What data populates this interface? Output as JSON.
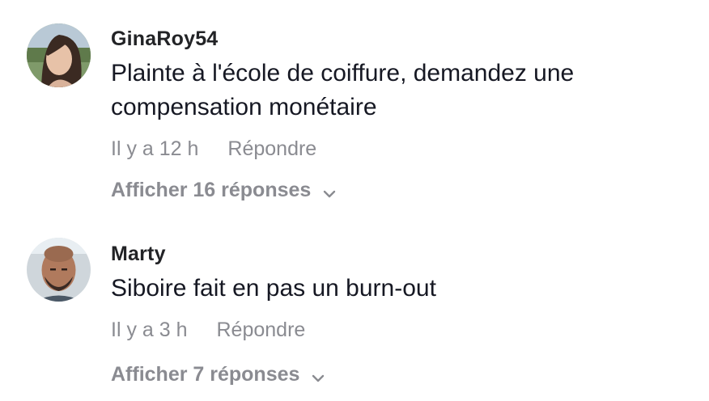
{
  "comments": [
    {
      "username": "GinaRoy54",
      "text": "Plainte à l'école de coiffure, demandez une compensation monétaire",
      "time": "Il y a 12 h",
      "reply_label": "Répondre",
      "view_replies": "Afficher 16 réponses",
      "icon": "chevron-down-icon"
    },
    {
      "username": "Marty",
      "text": "Siboire fait en pas un burn-out",
      "time": "Il y a 3 h",
      "reply_label": "Répondre",
      "view_replies": "Afficher 7 réponses",
      "icon": "chevron-down-icon"
    }
  ],
  "colors": {
    "text_primary": "#161823",
    "text_secondary": "#8a8b91",
    "background": "#ffffff"
  }
}
